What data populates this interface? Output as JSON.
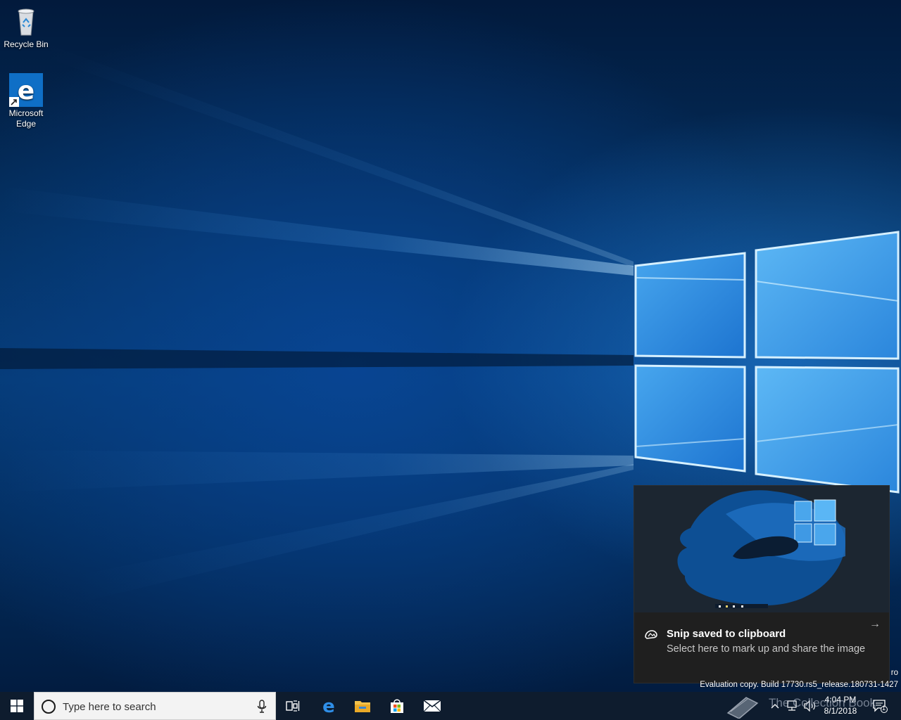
{
  "desktop": {
    "icons": [
      {
        "label": "Recycle Bin"
      },
      {
        "label": "Microsoft Edge"
      }
    ]
  },
  "toast": {
    "title": "Snip saved to clipboard",
    "body": "Select here to mark up and share the image",
    "arrow": "→"
  },
  "watermark": {
    "line1": "ro",
    "line2": "Evaluation copy. Build 17730.rs5_release.180731-1427"
  },
  "taskbar": {
    "search_placeholder": "Type here to search",
    "apps": [
      "task-view",
      "microsoft-edge",
      "file-explorer",
      "microsoft-store",
      "mail"
    ],
    "clock": {
      "time": "4:04 PM",
      "date": "8/1/2018"
    },
    "notification_count": "1",
    "overlay_text": "The Collection Book"
  },
  "colors": {
    "taskbar": "#0e1c2e",
    "accent": "#0078d7",
    "toast_bg": "#1f1f1f"
  }
}
